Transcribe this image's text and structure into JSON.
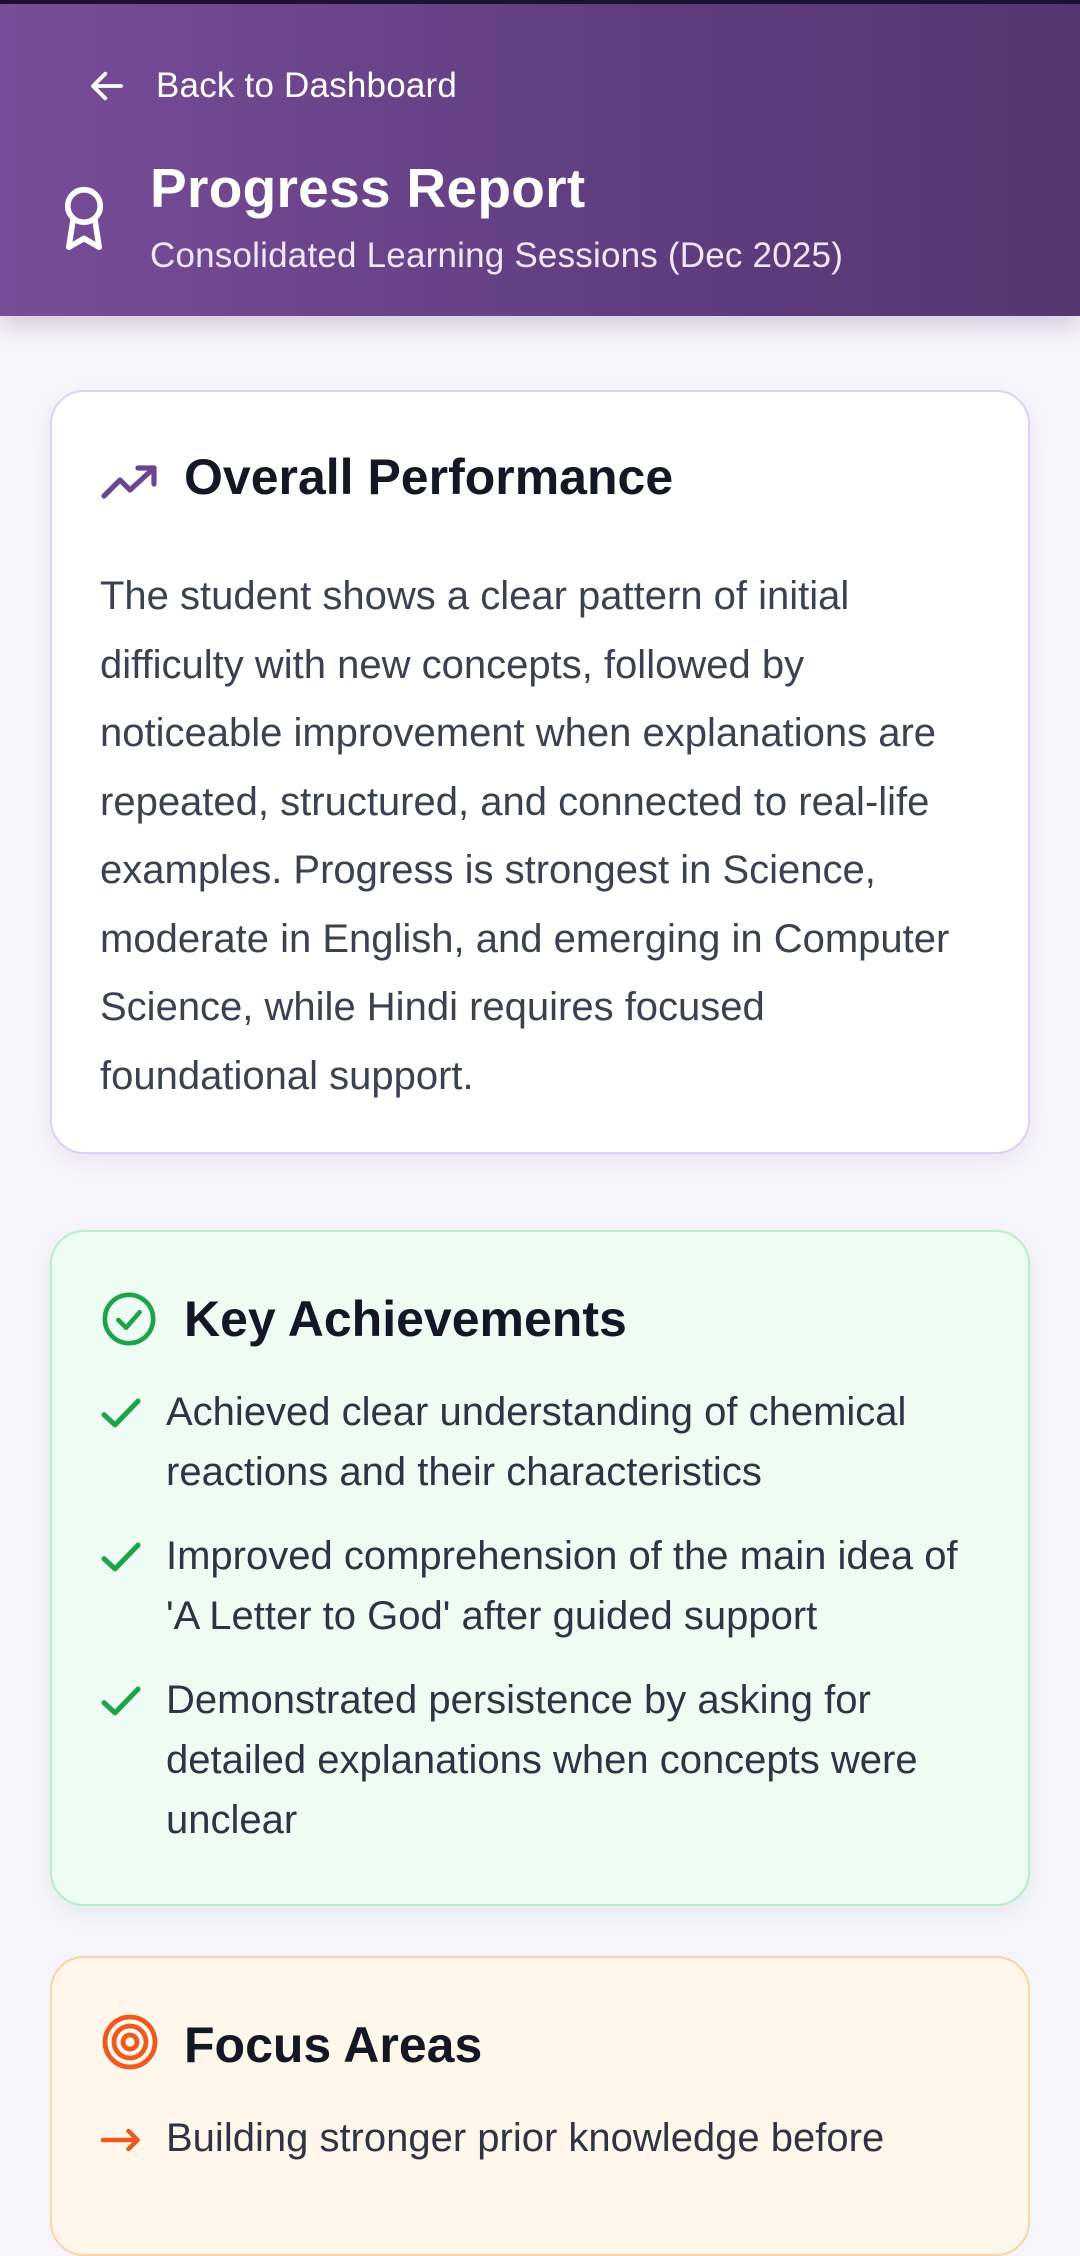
{
  "header": {
    "back_label": "Back to Dashboard",
    "title": "Progress Report",
    "subtitle": "Consolidated Learning Sessions (Dec 2025)",
    "back_icon": "arrow-left-icon",
    "title_icon": "award-icon"
  },
  "overall": {
    "title": "Overall Performance",
    "icon": "trending-up-icon",
    "text": "The student shows a clear pattern of initial difficulty with new concepts, followed by noticeable improvement when explanations are repeated, structured, and connected to real-life examples. Progress is strongest in Science, moderate in English, and emerging in Computer Science, while Hindi requires focused foundational support."
  },
  "achievements": {
    "title": "Key Achievements",
    "icon": "check-circle-icon",
    "items": [
      "Achieved clear understanding of chemical reactions and their characteristics",
      "Improved comprehension of the main idea of 'A Letter to God' after guided support",
      "Demonstrated persistence by asking for detailed explanations when concepts were unclear"
    ]
  },
  "focus": {
    "title": "Focus Areas",
    "icon": "target-icon",
    "items": [
      "Building stronger prior knowledge before"
    ]
  },
  "colors": {
    "header_start": "#784d98",
    "header_end": "#553672",
    "accent_purple": "#6b4591",
    "success_green": "#1fa34a",
    "focus_orange": "#ec5a1f",
    "page_background": "#f7f5fc"
  }
}
